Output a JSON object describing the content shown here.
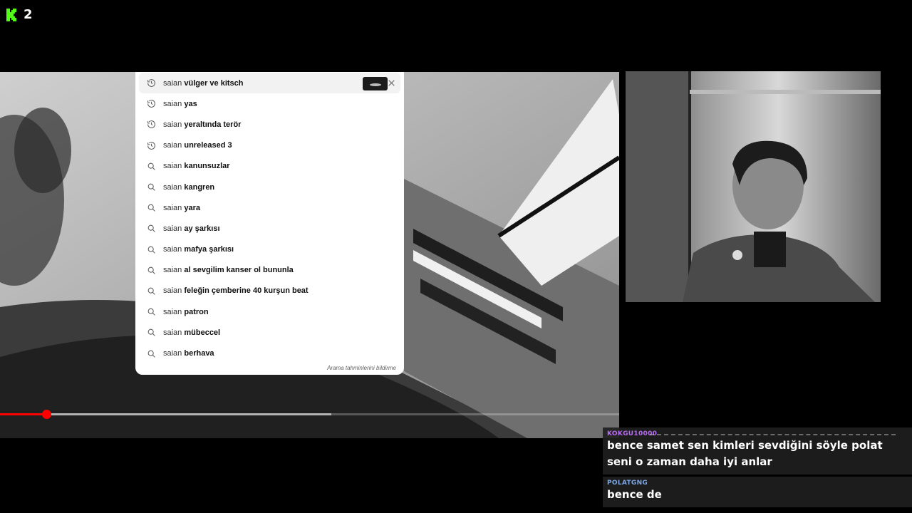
{
  "brand": {
    "badge_number": "2",
    "accent": "#53fc18"
  },
  "search": {
    "query": "saian",
    "suggestions": [
      {
        "type": "history",
        "rest": "vülger ve kitsch",
        "active": true
      },
      {
        "type": "history",
        "rest": "yas"
      },
      {
        "type": "history",
        "rest": "yeraltında terör"
      },
      {
        "type": "history",
        "rest": "unreleased 3"
      },
      {
        "type": "search",
        "rest": "kanunsuzlar"
      },
      {
        "type": "search",
        "rest": "kangren"
      },
      {
        "type": "search",
        "rest": "yara"
      },
      {
        "type": "search",
        "rest": "ay şarkısı"
      },
      {
        "type": "search",
        "rest": "mafya şarkısı"
      },
      {
        "type": "search",
        "rest": "al sevgilim kanser ol bununla"
      },
      {
        "type": "search",
        "rest": "feleğin çemberine 40 kurşun beat"
      },
      {
        "type": "search",
        "rest": "patron"
      },
      {
        "type": "search",
        "rest": "mübeccel"
      },
      {
        "type": "search",
        "rest": "berhava"
      }
    ],
    "report_label": "Arama tahminlerini bildirme"
  },
  "player": {
    "progress_fraction": 0.075,
    "buffered_fraction": 0.535,
    "progress_color": "#ff0000"
  },
  "chat": {
    "messages": [
      {
        "user": "KOKGU10000",
        "user_color": "#b86cf2",
        "text": "bence samet sen kimleri sevdiğini söyle polat seni o zaman daha iyi anlar"
      },
      {
        "user": "POLATGNG",
        "user_color": "#7aa7e8",
        "text": "bence de"
      }
    ]
  }
}
